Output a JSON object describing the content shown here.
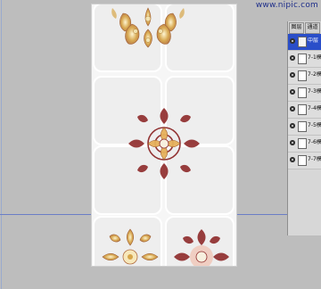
{
  "watermark": "www.nipic.com",
  "colors": {
    "workspace": "#bdbdbd",
    "tile_bg": "#eeeeee",
    "tile_border": "#ffffff",
    "guide_line": "#6a7ec6",
    "layer_selected": "#2a4ec9",
    "ornament_gold": "#d7a64a",
    "ornament_maroon": "#8e2a2a"
  },
  "layers_panel": {
    "tabs": [
      "图层",
      "通道"
    ],
    "layers": [
      {
        "name": "中层",
        "selected": true,
        "icon": "layer-thumbnail-icon"
      },
      {
        "name": "7-1模",
        "selected": false,
        "icon": "layer-thumbnail-icon"
      },
      {
        "name": "7-2模",
        "selected": false,
        "icon": "layer-thumbnail-icon"
      },
      {
        "name": "7-3模",
        "selected": false,
        "icon": "layer-thumbnail-icon"
      },
      {
        "name": "7-4模",
        "selected": false,
        "icon": "layer-thumbnail-icon"
      },
      {
        "name": "7-5模",
        "selected": false,
        "icon": "layer-thumbnail-icon"
      },
      {
        "name": "7-6模",
        "selected": false,
        "icon": "layer-thumbnail-icon"
      },
      {
        "name": "7-7模",
        "selected": false,
        "icon": "layer-thumbnail-icon"
      }
    ]
  }
}
